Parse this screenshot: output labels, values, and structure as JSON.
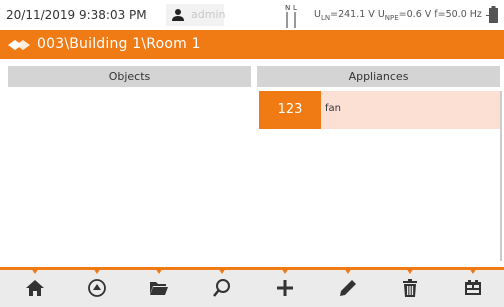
{
  "status": {
    "datetime": "20/11/2019 9:38:03 PM",
    "user": "admin",
    "readings_uln_label": "U",
    "readings_uln_sub": "LN",
    "readings_uln_value": "=241.1 V",
    "readings_upe_label": " U",
    "readings_upe_sub": "NPE",
    "readings_upe_value": "=0.6 V",
    "readings_freq": " f=50.0 Hz",
    "nl_n": "N",
    "nl_l": "L"
  },
  "location": {
    "path": "003\\Building 1\\Room 1"
  },
  "panels": {
    "objects_title": "Objects",
    "appliances_title": "Appliances"
  },
  "appliances": [
    {
      "number": "123",
      "name": "fan"
    }
  ],
  "toolbar": {
    "icons": [
      "home-icon",
      "up-level-icon",
      "folder-icon",
      "search-icon",
      "add-icon",
      "edit-icon",
      "delete-icon",
      "measure-icon"
    ]
  },
  "colors": {
    "accent": "#f07b14",
    "selection_bg": "#fde0d4",
    "header_bg": "#d4d4d4",
    "toolbar_bg": "#ebebeb"
  }
}
